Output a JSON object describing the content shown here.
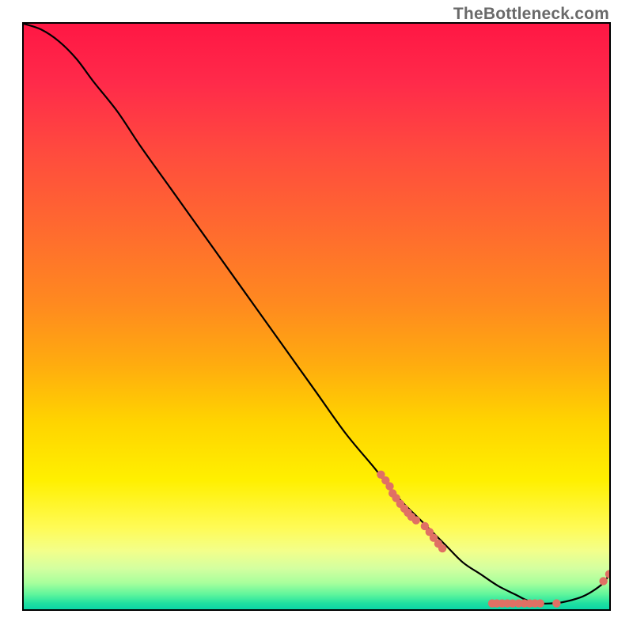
{
  "watermark": "TheBottleneck.com",
  "chart_data": {
    "type": "line",
    "title": "",
    "xlabel": "",
    "ylabel": "",
    "xlim": [
      0,
      100
    ],
    "ylim": [
      0,
      100
    ],
    "curve": {
      "x": [
        0,
        3,
        6,
        9,
        12,
        16,
        20,
        25,
        30,
        35,
        40,
        45,
        50,
        55,
        60,
        64,
        68,
        72,
        75,
        78,
        81,
        84,
        86,
        88,
        90,
        92,
        95,
        97,
        99,
        100
      ],
      "y": [
        100,
        99,
        97,
        94,
        90,
        85,
        79,
        72,
        65,
        58,
        51,
        44,
        37,
        30,
        24,
        19,
        15,
        11,
        8,
        6,
        4,
        2.5,
        1.5,
        1,
        1,
        1.2,
        2,
        3,
        4.5,
        6
      ]
    },
    "scatter_clusters": [
      {
        "name": "upper-marks",
        "points": [
          [
            61,
            23
          ],
          [
            61.8,
            22
          ],
          [
            62.5,
            21
          ],
          [
            63,
            19.8
          ],
          [
            63.6,
            19
          ],
          [
            64.3,
            18
          ],
          [
            65,
            17.2
          ],
          [
            65.6,
            16.5
          ],
          [
            66.2,
            15.8
          ],
          [
            67,
            15.2
          ]
        ]
      },
      {
        "name": "mid-marks",
        "points": [
          [
            68.5,
            14.2
          ],
          [
            69.3,
            13.2
          ],
          [
            70,
            12.2
          ],
          [
            70.8,
            11.2
          ],
          [
            71.5,
            10.4
          ]
        ]
      },
      {
        "name": "bottom-marks",
        "points": [
          [
            80,
            1.0
          ],
          [
            80.8,
            1.0
          ],
          [
            81.7,
            1.0
          ],
          [
            82.6,
            1.0
          ],
          [
            83.5,
            1.0
          ],
          [
            84.5,
            1.0
          ],
          [
            85.5,
            1.0
          ],
          [
            86.4,
            1.0
          ],
          [
            87.3,
            1.0
          ],
          [
            88.2,
            1.0
          ],
          [
            91,
            1.0
          ]
        ]
      },
      {
        "name": "tail-marks",
        "points": [
          [
            99,
            4.8
          ],
          [
            100,
            6
          ]
        ]
      }
    ],
    "gradient_stops": [
      {
        "offset": 0.0,
        "color": "#ff1744"
      },
      {
        "offset": 0.1,
        "color": "#ff2a4a"
      },
      {
        "offset": 0.22,
        "color": "#ff4b3e"
      },
      {
        "offset": 0.35,
        "color": "#ff6a2f"
      },
      {
        "offset": 0.48,
        "color": "#ff8a1f"
      },
      {
        "offset": 0.58,
        "color": "#ffab0f"
      },
      {
        "offset": 0.68,
        "color": "#ffd400"
      },
      {
        "offset": 0.78,
        "color": "#fff000"
      },
      {
        "offset": 0.86,
        "color": "#fffb55"
      },
      {
        "offset": 0.9,
        "color": "#f3ff8a"
      },
      {
        "offset": 0.93,
        "color": "#d4ffa0"
      },
      {
        "offset": 0.955,
        "color": "#a8ff9c"
      },
      {
        "offset": 0.975,
        "color": "#5ef59c"
      },
      {
        "offset": 0.99,
        "color": "#1fe0a0"
      },
      {
        "offset": 1.0,
        "color": "#0cd6a6"
      }
    ],
    "marker_color": "#e07064",
    "line_color": "#000000"
  }
}
